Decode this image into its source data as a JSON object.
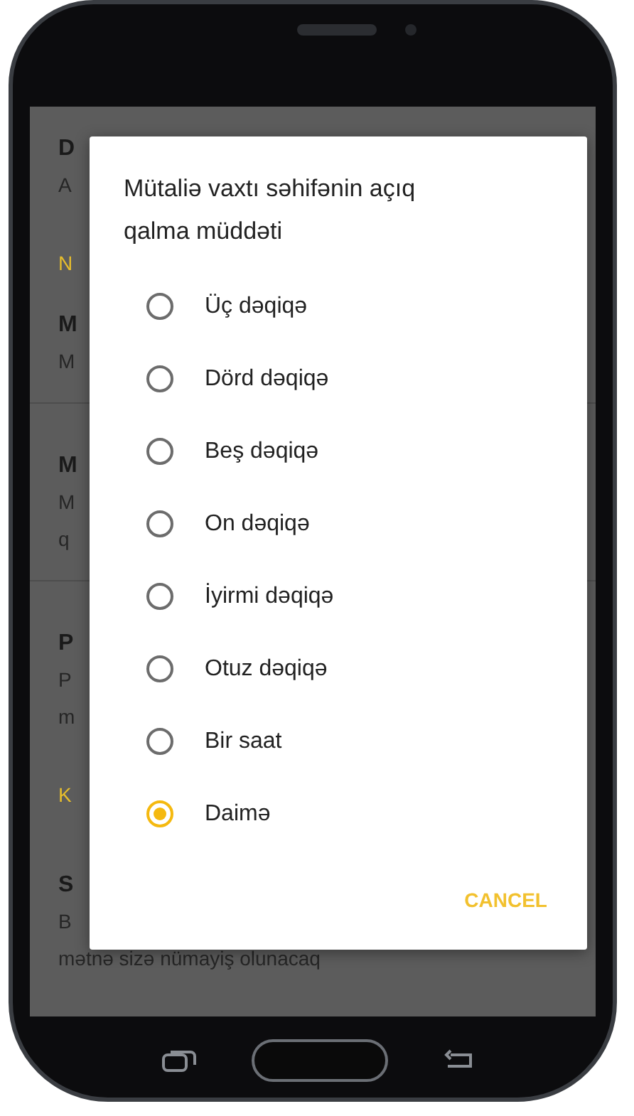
{
  "background_list": [
    {
      "kind": "title",
      "text": "D"
    },
    {
      "kind": "sub",
      "text": "A"
    },
    {
      "kind": "header",
      "text": "N"
    },
    {
      "kind": "title",
      "text": "M"
    },
    {
      "kind": "sub",
      "text": "M"
    },
    {
      "kind": "divider"
    },
    {
      "kind": "title",
      "text": "M"
    },
    {
      "kind": "sub",
      "text": "M"
    },
    {
      "kind": "sub",
      "text": "q"
    },
    {
      "kind": "divider"
    },
    {
      "kind": "title",
      "text": "P"
    },
    {
      "kind": "sub",
      "text": "P"
    },
    {
      "kind": "sub",
      "text": "m"
    },
    {
      "kind": "header",
      "text": "K"
    },
    {
      "kind": "title",
      "text": "S"
    },
    {
      "kind": "sub",
      "text": "B"
    },
    {
      "kind": "sub",
      "text": "mətnə sizə nümayiş olunacaq"
    }
  ],
  "dialog": {
    "title": "Mütaliə vaxtı səhifənin açıq qalma müddəti",
    "options": [
      {
        "label": "Üç dəqiqə",
        "selected": false
      },
      {
        "label": "Dörd dəqiqə",
        "selected": false
      },
      {
        "label": "Beş dəqiqə",
        "selected": false
      },
      {
        "label": "On dəqiqə",
        "selected": false
      },
      {
        "label": "İyirmi dəqiqə",
        "selected": false
      },
      {
        "label": "Otuz dəqiqə",
        "selected": false
      },
      {
        "label": "Bir saat",
        "selected": false
      },
      {
        "label": "Daimə",
        "selected": true
      }
    ],
    "buttons": [
      "CANCEL"
    ]
  }
}
